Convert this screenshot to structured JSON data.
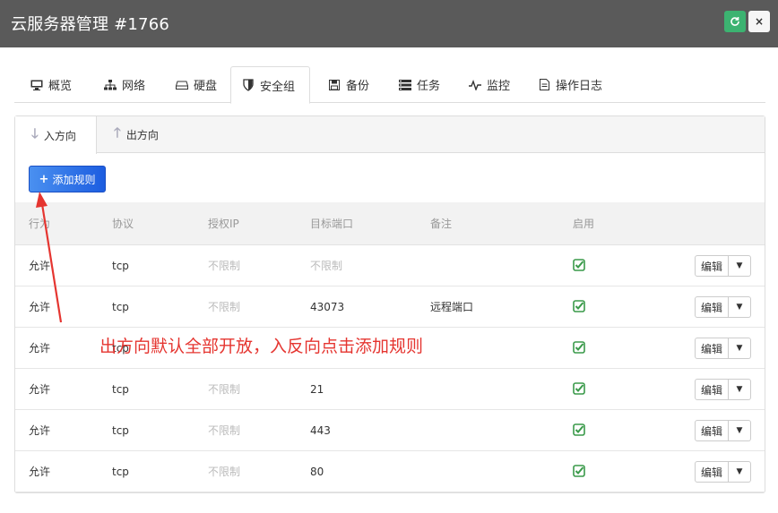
{
  "window": {
    "title": "云服务器管理 #1766",
    "refresh_icon": "refresh-icon",
    "close_icon": "close-icon"
  },
  "tabs": [
    {
      "label": "概览",
      "icon": "monitor-icon"
    },
    {
      "label": "网络",
      "icon": "network-icon"
    },
    {
      "label": "硬盘",
      "icon": "disk-icon"
    },
    {
      "label": "安全组",
      "icon": "shield-icon",
      "active": true
    },
    {
      "label": "备份",
      "icon": "save-icon"
    },
    {
      "label": "任务",
      "icon": "tasks-icon"
    },
    {
      "label": "监控",
      "icon": "pulse-icon"
    },
    {
      "label": "操作日志",
      "icon": "file-icon"
    }
  ],
  "subtabs": [
    {
      "label": "入方向",
      "icon": "arrow-down-icon",
      "active": true
    },
    {
      "label": "出方向",
      "icon": "arrow-up-icon"
    }
  ],
  "add_button": {
    "label": "添加规则",
    "icon": "plus-icon"
  },
  "table": {
    "headers": [
      "行为",
      "协议",
      "授权IP",
      "目标端口",
      "备注",
      "启用"
    ],
    "rows": [
      {
        "action": "允许",
        "protocol": "tcp",
        "ip": "不限制",
        "port": "不限制",
        "note": "",
        "enabled": true,
        "edit": "编辑"
      },
      {
        "action": "允许",
        "protocol": "tcp",
        "ip": "不限制",
        "port": "43073",
        "note": "远程端口",
        "enabled": true,
        "edit": "编辑"
      },
      {
        "action": "允许",
        "protocol": "tcp",
        "ip": "",
        "port": "",
        "note": "",
        "enabled": true,
        "edit": "编辑"
      },
      {
        "action": "允许",
        "protocol": "tcp",
        "ip": "不限制",
        "port": "21",
        "note": "",
        "enabled": true,
        "edit": "编辑"
      },
      {
        "action": "允许",
        "protocol": "tcp",
        "ip": "不限制",
        "port": "443",
        "note": "",
        "enabled": true,
        "edit": "编辑"
      },
      {
        "action": "允许",
        "protocol": "tcp",
        "ip": "不限制",
        "port": "80",
        "note": "",
        "enabled": true,
        "edit": "编辑"
      }
    ]
  },
  "annotation": {
    "text": "出方向默认全部开放，入反向点击添加规则",
    "color": "#e53530"
  },
  "colors": {
    "titlebar": "#5a5a5a",
    "refresh": "#3cb371",
    "check": "#3a9a4a",
    "primary": "#2f6fe6"
  }
}
